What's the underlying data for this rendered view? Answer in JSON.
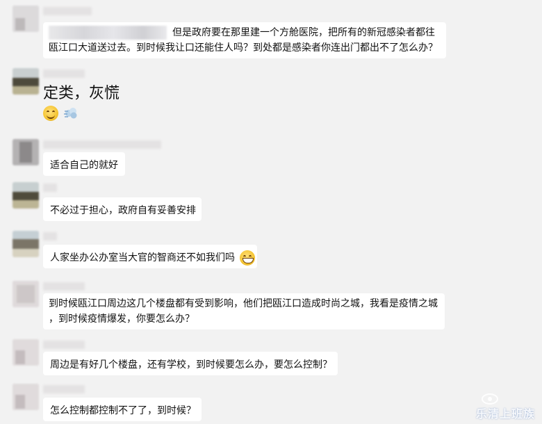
{
  "messages": [
    {
      "text": "但是政府要在那里建一个方舱医院，把所有的新冠感染者都往",
      "text2": "瓯江口大道送过去。到时候我让口还能住人吗？到处都是感染者你连出门都出不了怎么办？"
    },
    {
      "text": "定类，灰慌"
    },
    {
      "text": "适合自己的就好"
    },
    {
      "text": "不必过于担心，政府自有妥善安排"
    },
    {
      "text": "人家坐办公办室当大官的智商还不如我们吗"
    },
    {
      "text": "到时候瓯江口周边这几个楼盘都有受到影响，他们把瓯江口造成时尚之城，我看是疫情之城",
      "text2": "，到时候疫情爆发，你要怎么办？"
    },
    {
      "text": "周边是有好几个楼盘，还有学校，到时候要怎么办，要怎么控制？"
    },
    {
      "text": "怎么控制都控制不了了，到时候？"
    }
  ],
  "emojis": {
    "smile": "smile-emoji",
    "steam": "steam-emoji",
    "grin": "grin-emoji"
  },
  "watermark": {
    "text": "乐清上班族"
  },
  "colors": {
    "background": "#f2f2f2",
    "bubble": "#ffffff"
  }
}
